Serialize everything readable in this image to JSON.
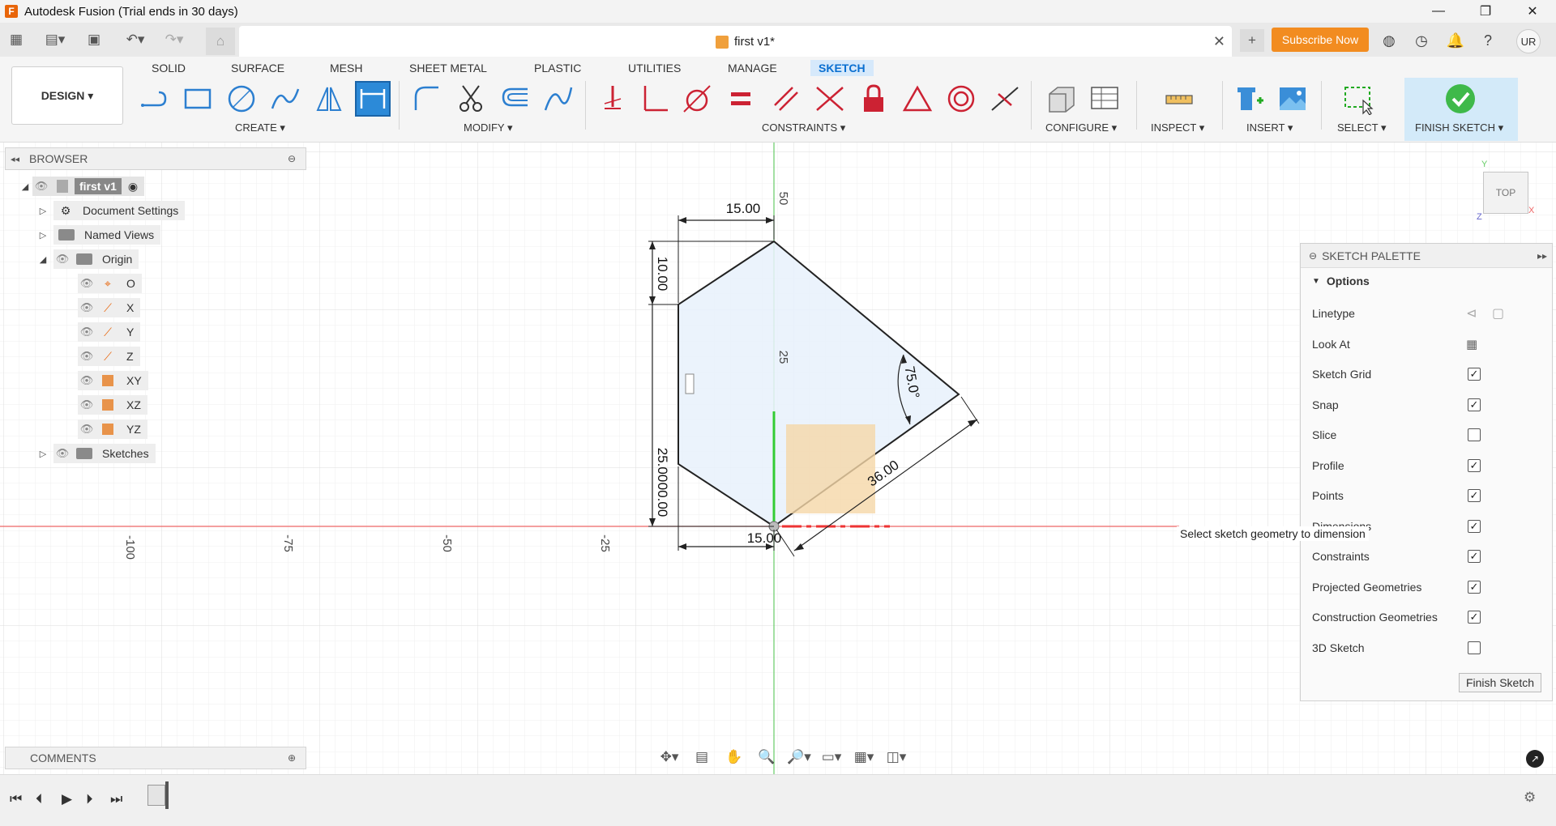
{
  "window": {
    "title": "Autodesk Fusion (Trial ends in 30 days)"
  },
  "document": {
    "tab_title": "first v1*",
    "subscribe_label": "Subscribe Now",
    "user_initials": "UR"
  },
  "workspace": {
    "label": "DESIGN"
  },
  "tabs": [
    {
      "label": "SOLID"
    },
    {
      "label": "SURFACE"
    },
    {
      "label": "MESH"
    },
    {
      "label": "SHEET METAL"
    },
    {
      "label": "PLASTIC"
    },
    {
      "label": "UTILITIES"
    },
    {
      "label": "MANAGE"
    },
    {
      "label": "SKETCH"
    }
  ],
  "active_tab": "SKETCH",
  "groups": {
    "create": "CREATE",
    "modify": "MODIFY",
    "constraints": "CONSTRAINTS",
    "configure": "CONFIGURE",
    "inspect": "INSPECT",
    "insert": "INSERT",
    "select": "SELECT",
    "finish": "FINISH SKETCH"
  },
  "browser": {
    "title": "BROWSER",
    "root": "first v1",
    "items": {
      "doc_settings": "Document Settings",
      "named_views": "Named Views",
      "origin": "Origin",
      "o": "O",
      "x": "X",
      "y": "Y",
      "z": "Z",
      "xy": "XY",
      "xz": "XZ",
      "yz": "YZ",
      "sketches": "Sketches"
    }
  },
  "comments": {
    "title": "COMMENTS"
  },
  "viewcube": {
    "face": "TOP",
    "axis_y": "Y",
    "axis_x": "X",
    "axis_z": "Z"
  },
  "sketch": {
    "dims": {
      "top_width": "15.00",
      "bottom_width": "15.00",
      "left_top": "10.00",
      "left_bottom": "25.00",
      "left_bottom2": "00.00",
      "diag": "36.00",
      "angle": "75.0°",
      "axis_50": "50",
      "axis_25": "25"
    },
    "axis_ticks": [
      "-100",
      "-75",
      "-50",
      "-25"
    ]
  },
  "tooltip": "Select sketch geometry to dimension",
  "palette": {
    "title": "SKETCH PALETTE",
    "section": "Options",
    "rows": [
      {
        "label": "Linetype",
        "kind": "icons"
      },
      {
        "label": "Look At",
        "kind": "icon"
      },
      {
        "label": "Sketch Grid",
        "checked": "✓"
      },
      {
        "label": "Snap",
        "checked": "✓"
      },
      {
        "label": "Slice",
        "checked": ""
      },
      {
        "label": "Profile",
        "checked": "✓"
      },
      {
        "label": "Points",
        "checked": "✓"
      },
      {
        "label": "Dimensions",
        "checked": "✓"
      },
      {
        "label": "Constraints",
        "checked": "✓"
      },
      {
        "label": "Projected Geometries",
        "checked": "✓"
      },
      {
        "label": "Construction Geometries",
        "checked": "✓"
      },
      {
        "label": "3D Sketch",
        "checked": ""
      }
    ],
    "finish_label": "Finish Sketch"
  }
}
